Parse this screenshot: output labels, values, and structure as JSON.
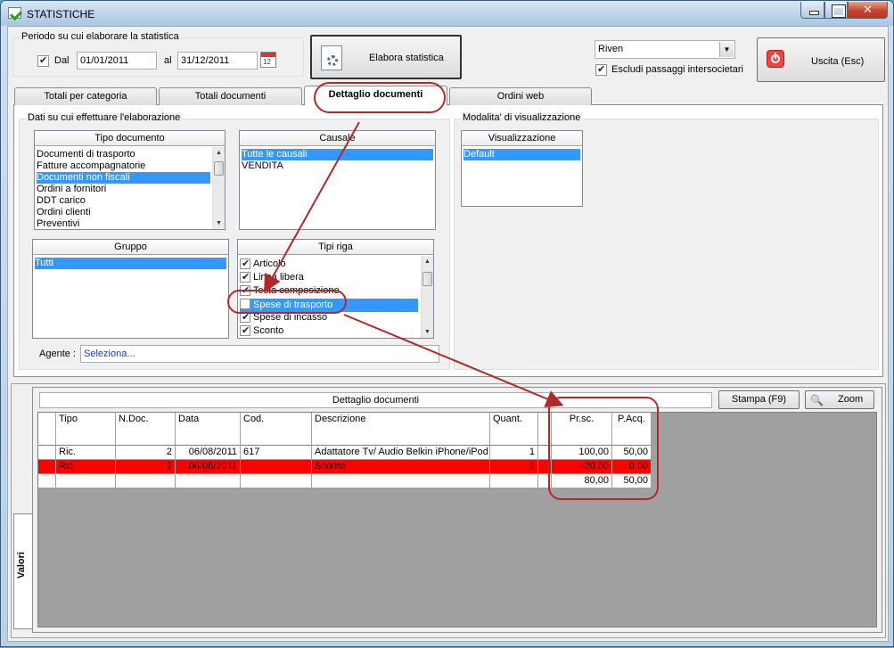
{
  "window": {
    "title": "STATISTICHE"
  },
  "period": {
    "group_title": "Periodo su cui elaborare la statistica",
    "dal_label": "Dal",
    "dal_checked": true,
    "from_date": "01/01/2011",
    "al_label": "al",
    "to_date": "31/12/2011"
  },
  "toolbar": {
    "elabora_label": "Elabora statistica",
    "company_select": "Riven",
    "exclude_label": "Escludi passaggi intersocietari",
    "exclude_checked": true,
    "exit_label": "Uscita (Esc)"
  },
  "tabs": [
    {
      "label": "Totali per categoria",
      "active": false
    },
    {
      "label": "Totali documenti",
      "active": false
    },
    {
      "label": "Dettaglio documenti",
      "active": true
    },
    {
      "label": "Ordini web",
      "active": false
    }
  ],
  "filters": {
    "group_title": "Dati su cui effettuare l'elaborazione",
    "tipo_documento": {
      "header": "Tipo documento",
      "items": [
        "Documenti di trasporto",
        "Fatture accompagnatorie",
        "Documenti non fiscali",
        "Ordini a fornitori",
        "DDT carico",
        "Ordini clienti",
        "Preventivi"
      ],
      "selected_index": 2
    },
    "causale": {
      "header": "Causale",
      "items": [
        "Tutte le causali",
        "VENDITA"
      ],
      "selected_index": 0
    },
    "gruppo": {
      "header": "Gruppo",
      "items": [
        "Tutti"
      ],
      "selected_index": 0
    },
    "tipi_riga": {
      "header": "Tipi riga",
      "items": [
        {
          "label": "Articolo",
          "checked": true
        },
        {
          "label": "Linea libera",
          "checked": true
        },
        {
          "label": "Testa composizione",
          "checked": true
        },
        {
          "label": "Spese di trasporto",
          "checked": false
        },
        {
          "label": "Spese di incasso",
          "checked": true
        },
        {
          "label": "Sconto",
          "checked": true
        }
      ],
      "selected_index": 3
    },
    "agente_label": "Agente :",
    "agente_value": "Seleziona..."
  },
  "visualization": {
    "group_title": "Modalita' di visualizzazione",
    "header": "Visualizzazione",
    "items": [
      "Default"
    ],
    "selected_index": 0
  },
  "results": {
    "side_tab": "Valori",
    "title": "Dettaglio documenti",
    "print_label": "Stampa (F9)",
    "zoom_label": "Zoom",
    "columns": [
      "Tipo",
      "N.Doc.",
      "Data",
      "Cod.",
      "Descrizione",
      "Quant.",
      "Pr.sc.",
      "P.Acq."
    ],
    "rows": [
      [
        "Ric.",
        "2",
        "06/08/2011",
        "617",
        "Adattatore Tv/ Audio Belkin iPhone/iPod",
        "1",
        "100,00",
        "50,00"
      ],
      [
        "Ric.",
        "2",
        "06/08/2011",
        "",
        "Sconto",
        "1",
        "-20,00",
        "0,00"
      ],
      [
        "",
        "",
        "",
        "",
        "",
        "",
        "80,00",
        "50,00"
      ]
    ],
    "highlight_row": 1,
    "colors": {
      "highlight": "#ff0000",
      "grid_bg": "#a0a0a0",
      "annotation": "#b12a2a"
    }
  }
}
